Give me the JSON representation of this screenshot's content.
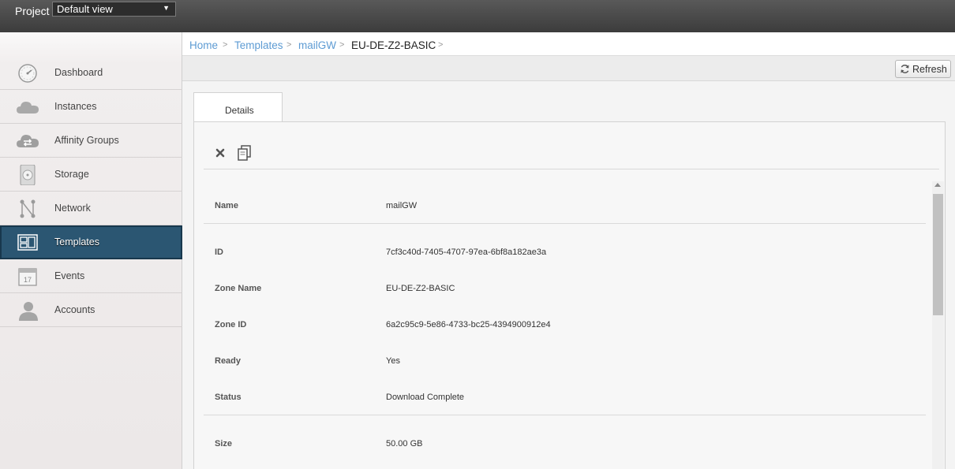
{
  "topbar": {
    "project_label": "Project",
    "project_select_value": "Default view",
    "project_select_arrow": "▼"
  },
  "sidebar": {
    "items": [
      {
        "label": "Dashboard",
        "icon": "dashboard-icon"
      },
      {
        "label": "Instances",
        "icon": "cloud-icon"
      },
      {
        "label": "Affinity Groups",
        "icon": "affinity-cloud-icon"
      },
      {
        "label": "Storage",
        "icon": "disk-icon"
      },
      {
        "label": "Network",
        "icon": "network-icon"
      },
      {
        "label": "Templates",
        "icon": "templates-icon",
        "active": true
      },
      {
        "label": "Events",
        "icon": "calendar-icon"
      },
      {
        "label": "Accounts",
        "icon": "user-icon"
      }
    ],
    "events_calendar_day": "17"
  },
  "breadcrumb": {
    "items": [
      "Home",
      "Templates",
      "mailGW",
      "EU-DE-Z2-BASIC"
    ],
    "separator": ">"
  },
  "toolbar": {
    "refresh_label": "Refresh"
  },
  "tabs": {
    "details_label": "Details"
  },
  "details": {
    "name": {
      "label": "Name",
      "value": "mailGW"
    },
    "id": {
      "label": "ID",
      "value": "7cf3c40d-7405-4707-97ea-6bf8a182ae3a"
    },
    "zone_name": {
      "label": "Zone Name",
      "value": "EU-DE-Z2-BASIC"
    },
    "zone_id": {
      "label": "Zone ID",
      "value": "6a2c95c9-5e86-4733-bc25-4394900912e4"
    },
    "ready": {
      "label": "Ready",
      "value": "Yes"
    },
    "status": {
      "label": "Status",
      "value": "Download Complete"
    },
    "size": {
      "label": "Size",
      "value": "50.00 GB"
    }
  },
  "colors": {
    "accent_link": "#5d9bd3",
    "active_nav": "#2b5672",
    "topbar": "#4a4a4a"
  }
}
